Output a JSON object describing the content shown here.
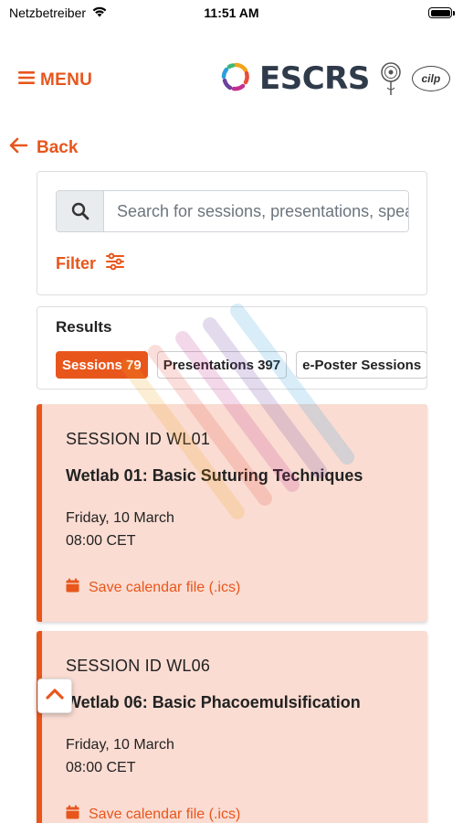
{
  "status_bar": {
    "carrier": "Netzbetreiber",
    "time": "11:51 AM"
  },
  "header": {
    "menu_label": "MENU",
    "logo_text": "ESCRS",
    "partner_logo_text": "cilp"
  },
  "back": {
    "label": "Back"
  },
  "search": {
    "placeholder": "Search for sessions, presentations, speakers",
    "value": "",
    "filter_label": "Filter"
  },
  "results": {
    "title": "Results",
    "tabs": [
      {
        "label": "Sessions 79",
        "active": true
      },
      {
        "label": "Presentations 397",
        "active": false
      },
      {
        "label": "e-Poster Sessions",
        "active": false
      }
    ]
  },
  "sessions": [
    {
      "session_id": "SESSION ID WL01",
      "title": "Wetlab 01: Basic Suturing Techniques",
      "date": "Friday, 10 March",
      "time": "08:00 CET",
      "save_label": "Save calendar file (.ics)"
    },
    {
      "session_id": "SESSION ID WL06",
      "title": "Wetlab 06: Basic Phacoemulsification",
      "date": "Friday, 10 March",
      "time": "08:00 CET",
      "save_label": "Save calendar file (.ics)"
    }
  ],
  "colors": {
    "accent": "#e8561c",
    "card_background": "#fadcd2",
    "logo_text": "#2f3a4a"
  },
  "icons": {
    "wifi": "wifi-icon",
    "battery": "battery-icon",
    "menu": "hamburger-icon",
    "back": "arrow-left-icon",
    "search": "search-icon",
    "filter": "sliders-icon",
    "calendar": "calendar-icon",
    "scroll_top": "chevron-up-icon"
  }
}
